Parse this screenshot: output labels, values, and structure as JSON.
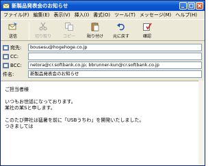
{
  "window": {
    "title": "新製品発表会のお知らせ"
  },
  "menu": [
    "ファイル(F)",
    "編集(E)",
    "表示(V)",
    "挿入(I)",
    "書式(O)",
    "ツール(T)",
    "メッセージ(M)",
    "ヘルプ(H)"
  ],
  "toolbar": {
    "send": "送信",
    "cut": "切り取り",
    "copy": "コピー",
    "paste": "貼り付け",
    "undo": "元に戻す",
    "check": "確認"
  },
  "fields": {
    "to_label": "宛先:",
    "to_value": "bousesu@hogehoge.co.jp",
    "cc_label": "CC:",
    "cc_value": "",
    "bcc_label": "BCC:",
    "bcc_value": "netora@cr.softbank.co.jp; bbrunner-kun@cr.softbank.co.jp",
    "subject_label": "件名:",
    "subject_value": "新製品発表会のお知らせ"
  },
  "body": {
    "line1": "ご担当者様",
    "line2": "いつもお世話になっております。",
    "line3": "某社の某Sと申します。",
    "line4": "このたび弊社は猛暑を前に「USBうちわ」を開発いたしました。",
    "line5": "つきましては"
  }
}
